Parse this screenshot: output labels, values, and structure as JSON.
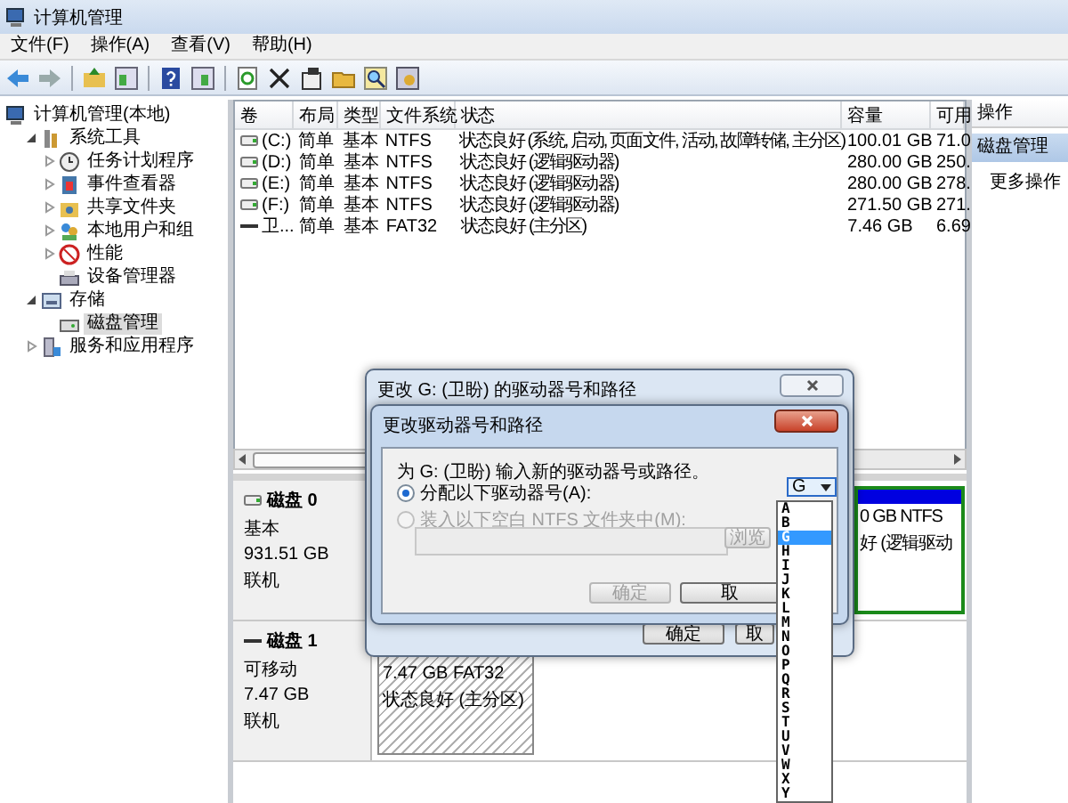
{
  "window": {
    "title": "计算机管理"
  },
  "menu": [
    "文件(F)",
    "操作(A)",
    "查看(V)",
    "帮助(H)"
  ],
  "tree": [
    {
      "label": "计算机管理(本地)",
      "selected": false,
      "children": [
        {
          "label": "系统工具",
          "expanded": true,
          "selected": false,
          "children": [
            {
              "label": "任务计划程序",
              "expanded": false,
              "selected": false
            },
            {
              "label": "事件查看器",
              "expanded": false,
              "selected": false
            },
            {
              "label": "共享文件夹",
              "expanded": false,
              "selected": false
            },
            {
              "label": "本地用户和组",
              "expanded": false,
              "selected": false
            },
            {
              "label": "性能",
              "expanded": false,
              "selected": false
            },
            {
              "label": "设备管理器",
              "selected": false
            }
          ]
        },
        {
          "label": "存储",
          "expanded": true,
          "selected": false,
          "children": [
            {
              "label": "磁盘管理",
              "selected": true
            }
          ]
        },
        {
          "label": "服务和应用程序",
          "expanded": false,
          "selected": false
        }
      ]
    }
  ],
  "volumes": {
    "columns": [
      "卷",
      "布局",
      "类型",
      "文件系统",
      "状态",
      "容量",
      "可用"
    ],
    "rows": [
      {
        "kind": "fixed",
        "cells": [
          "(C:)",
          "简单",
          "基本",
          "NTFS",
          "状态良好 (系统, 启动, 页面文件, 活动, 故障转储, 主分区)",
          "100.01 GB",
          "71.0"
        ]
      },
      {
        "kind": "fixed",
        "cells": [
          "(D:)",
          "简单",
          "基本",
          "NTFS",
          "状态良好 (逻辑驱动器)",
          "280.00 GB",
          "250."
        ]
      },
      {
        "kind": "fixed",
        "cells": [
          "(E:)",
          "简单",
          "基本",
          "NTFS",
          "状态良好 (逻辑驱动器)",
          "280.00 GB",
          "278."
        ]
      },
      {
        "kind": "fixed",
        "cells": [
          "(F:)",
          "简单",
          "基本",
          "NTFS",
          "状态良好 (逻辑驱动器)",
          "271.50 GB",
          "271."
        ]
      },
      {
        "kind": "removable",
        "cells": [
          "卫...",
          "简单",
          "基本",
          "FAT32",
          "状态良好 (主分区)",
          "7.46 GB",
          "6.69"
        ]
      }
    ]
  },
  "actions": {
    "header": "操作",
    "section": "磁盘管理",
    "items": [
      "更多操作"
    ]
  },
  "disks": [
    {
      "kind": "fixed",
      "name": "磁盘 0",
      "type": "基本",
      "size": "931.51 GB",
      "status": "联机",
      "partitions": [
        {
          "kind": "logical",
          "selected": false,
          "lines": [
            "0 GB NTFS",
            "好 (逻辑驱动"
          ]
        }
      ]
    },
    {
      "kind": "removable",
      "name": "磁盘 1",
      "type": "可移动",
      "size": "7.47 GB",
      "status": "联机",
      "partitions": [
        {
          "kind": "primary",
          "selected": true,
          "lines": [
            "7.47 GB FAT32",
            "状态良好 (主分区)"
          ]
        }
      ]
    }
  ],
  "outer_dialog": {
    "title": "更改 G: (卫盼) 的驱动器号和路径",
    "buttons": [
      {
        "label": "确定",
        "disabled": false
      },
      {
        "label": "取",
        "disabled": false
      }
    ]
  },
  "inner_dialog": {
    "title": "更改驱动器号和路径",
    "prompt": "为 G: (卫盼) 输入新的驱动器号或路径。",
    "options": [
      {
        "label": "分配以下驱动器号(A):",
        "selected": true,
        "disabled": false
      },
      {
        "label": "装入以下空白 NTFS 文件夹中(M):",
        "selected": false,
        "disabled": true
      }
    ],
    "path_field": {
      "disabled": true
    },
    "browse_button": {
      "label": "浏览",
      "disabled": true
    },
    "buttons": [
      {
        "label": "确定",
        "disabled": true
      },
      {
        "label": "取",
        "disabled": false
      }
    ],
    "drive_letter": {
      "value": "G",
      "expanded": true,
      "options": [
        {
          "label": "A",
          "selected": false
        },
        {
          "label": "B",
          "selected": false
        },
        {
          "label": "G",
          "selected": true
        },
        {
          "label": "H",
          "selected": false
        },
        {
          "label": "I",
          "selected": false
        },
        {
          "label": "J",
          "selected": false
        },
        {
          "label": "K",
          "selected": false
        },
        {
          "label": "L",
          "selected": false
        },
        {
          "label": "M",
          "selected": false
        },
        {
          "label": "N",
          "selected": false
        },
        {
          "label": "O",
          "selected": false
        },
        {
          "label": "P",
          "selected": false
        },
        {
          "label": "Q",
          "selected": false
        },
        {
          "label": "R",
          "selected": false
        },
        {
          "label": "S",
          "selected": false
        },
        {
          "label": "T",
          "selected": false
        },
        {
          "label": "U",
          "selected": false
        },
        {
          "label": "V",
          "selected": false
        },
        {
          "label": "W",
          "selected": false
        },
        {
          "label": "X",
          "selected": false
        },
        {
          "label": "Y",
          "selected": false
        }
      ]
    }
  }
}
